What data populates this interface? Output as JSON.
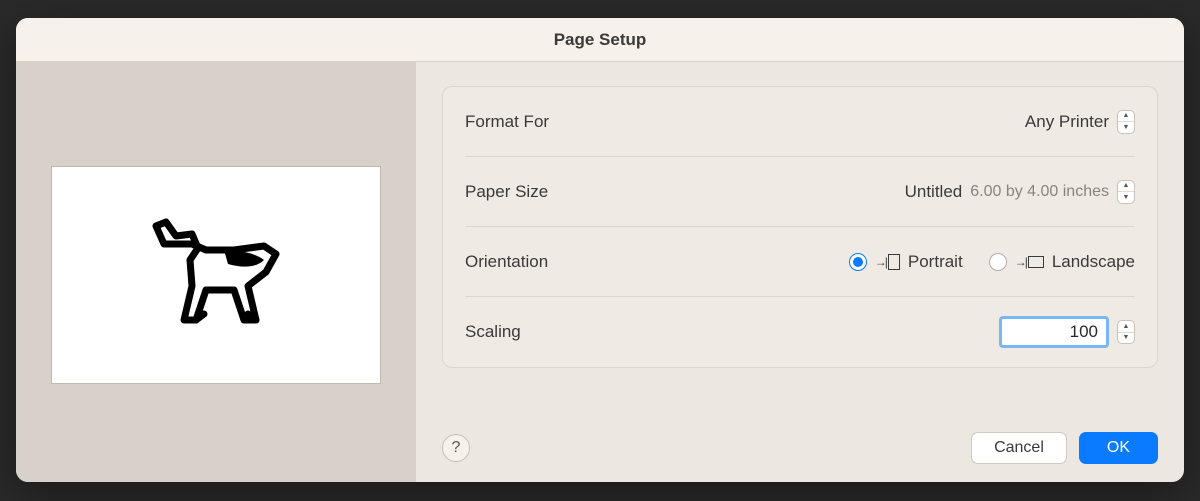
{
  "dialog": {
    "title": "Page Setup"
  },
  "settings": {
    "format_for": {
      "label": "Format For",
      "value": "Any Printer"
    },
    "paper_size": {
      "label": "Paper Size",
      "value": "Untitled",
      "dimensions": "6.00 by 4.00 inches"
    },
    "orientation": {
      "label": "Orientation",
      "options": {
        "portrait": "Portrait",
        "landscape": "Landscape"
      },
      "selected": "portrait"
    },
    "scaling": {
      "label": "Scaling",
      "value": "100"
    }
  },
  "footer": {
    "help": "?",
    "cancel": "Cancel",
    "ok": "OK"
  }
}
